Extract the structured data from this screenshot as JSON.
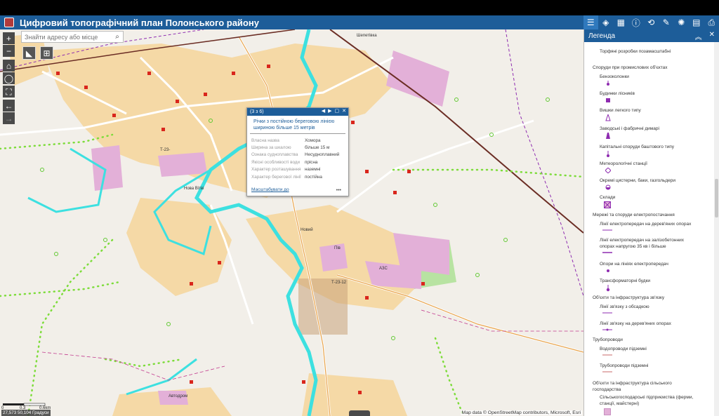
{
  "header": {
    "title": "Цифровий топографічний план Полонського району",
    "tools": [
      "list-icon",
      "layers-icon",
      "basemap-icon",
      "info-icon",
      "share-icon",
      "measure-icon",
      "settings-icon",
      "table-icon",
      "print-icon"
    ]
  },
  "search": {
    "placeholder": "Знайти адресу або місце"
  },
  "popup": {
    "counter": "(3 з 6)",
    "title": "Річки з постійною береговою лінією шириною більше 15 метрів",
    "rows": [
      {
        "key": "Власна назва",
        "value": "Хомора"
      },
      {
        "key": "Ширина за шкалою",
        "value": "більше 15 м"
      },
      {
        "key": "Ознака судноплавства",
        "value": "Несудноплавний"
      },
      {
        "key": "Якісні особливості води",
        "value": "прісна"
      },
      {
        "key": "Характер розташування",
        "value": "наземні"
      },
      {
        "key": "Характер берегової лінії",
        "value": "постійна"
      }
    ],
    "zoom_link": "Масштабувати до",
    "more": "•••"
  },
  "map": {
    "scale": {
      "zero": "0",
      "mid": "0.3",
      "end": "0.6km"
    },
    "coords": "27,573 50,104 Градуси",
    "attribution": "Map data © OpenStreetMap contributors, Microsoft, Esri",
    "labels": [
      {
        "text": "Шепетівка"
      },
      {
        "text": "Т-23-"
      },
      {
        "text": "Нова Вітві"
      },
      {
        "text": "Новий"
      },
      {
        "text": "Пів"
      },
      {
        "text": "АЗС"
      },
      {
        "text": "Т-23-12"
      },
      {
        "text": "Автодром"
      }
    ]
  },
  "legend": {
    "title": "Легенда",
    "items": [
      {
        "text": "Торфяні розробки позамасштабні",
        "indent": true
      },
      {
        "text": "Споруди при промислових об'єктах",
        "indent": false
      },
      {
        "text": "Бензоколонки",
        "indent": true
      },
      {
        "text": "Будинки лісників",
        "indent": true
      },
      {
        "text": "Вишки легкого типу",
        "indent": true
      },
      {
        "text": "Заводські і фабричні димарі",
        "indent": true
      },
      {
        "text": "Капітальні споруди баштового типу",
        "indent": true
      },
      {
        "text": "Метеорологічні станції",
        "indent": true
      },
      {
        "text": "Окремі цистерни, баки, газгольдери",
        "indent": true
      },
      {
        "text": "Склади",
        "indent": true
      },
      {
        "text": "Мережі та споруди електропостачання",
        "indent": false
      },
      {
        "text": "Лінії електропередач на дерев'яних опорах",
        "indent": true
      },
      {
        "text": "Лінії електропередач на залізобетонних",
        "indent": true
      },
      {
        "text": "опорах напругою 35 кв і більше",
        "indent": true
      },
      {
        "text": "Опори на лініях електропередач",
        "indent": true
      },
      {
        "text": "Трансформаторні будки",
        "indent": true
      },
      {
        "text": "Об'єкти та інфраструктура зв'язку",
        "indent": false
      },
      {
        "text": "Лінії зв'язку з обсадкою",
        "indent": true
      },
      {
        "text": "Лінії зв'язку на дерев'яних опорах",
        "indent": true
      },
      {
        "text": "Трубопроводи",
        "indent": false
      },
      {
        "text": "Водопроводи підземні",
        "indent": true
      },
      {
        "text": "Трубопроводи підземні",
        "indent": true
      },
      {
        "text": "Об'єкти та інфраструктура сільського",
        "indent": false
      },
      {
        "text": "господарства",
        "indent": false
      },
      {
        "text": "Сільськогосподарські підприємства (ферми,",
        "indent": true
      },
      {
        "text": "станції, майстерні)",
        "indent": true
      }
    ]
  },
  "colors": {
    "header": "#1d5d99",
    "river": "#3de0e0",
    "built_area": "#f5d9a6",
    "road": "#ffffff",
    "industrial": "#e3b0d8",
    "railway": "#6b2d24",
    "dots": "#7ddc3a"
  }
}
